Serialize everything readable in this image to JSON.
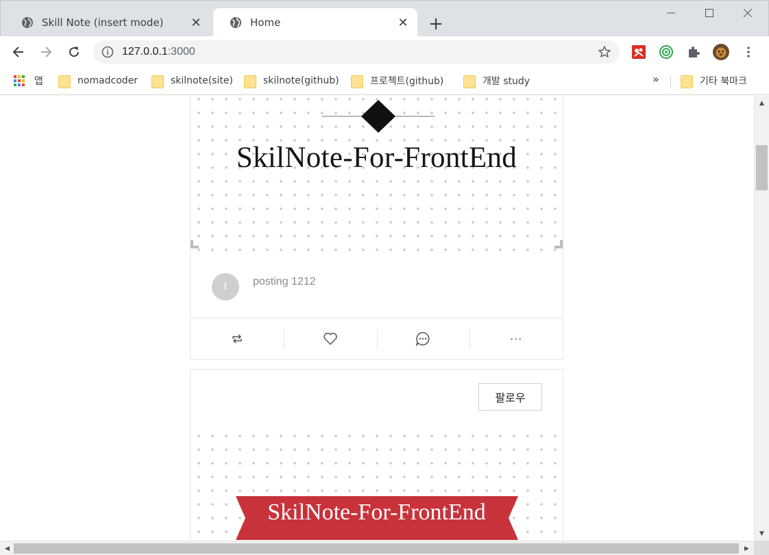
{
  "browser": {
    "tabs": [
      {
        "title": "Skill Note (insert mode)",
        "active": false
      },
      {
        "title": "Home",
        "active": true
      }
    ],
    "new_tab_label": "+",
    "close_glyph": "✕",
    "window_controls": {
      "minimize": "—",
      "maximize": "☐",
      "close": "✕"
    },
    "address": {
      "host": "127.0.0.1",
      "port": ":3000"
    },
    "bookmarks": [
      {
        "label": "앱",
        "icon": "apps-grid-icon"
      },
      {
        "label": "nomadcoder",
        "icon": "folder-icon"
      },
      {
        "label": "skilnote(site)",
        "icon": "folder-icon"
      },
      {
        "label": "skilnote(github)",
        "icon": "folder-icon"
      },
      {
        "label": "프로젝트(github)",
        "icon": "folder-icon"
      },
      {
        "label": "개발 study",
        "icon": "folder-icon"
      }
    ],
    "bookmarks_overflow": "»",
    "other_bookmarks": "기타 북마크",
    "colors": {
      "tabstrip": "#dee1e6",
      "omnibox": "#f1f3f4",
      "folder": "#fde293"
    }
  },
  "page": {
    "post1": {
      "banner_title": "SkilNote-For-FrontEnd",
      "avatar_initial": "t",
      "text": "posting 1212",
      "actions": [
        {
          "name": "repost",
          "icon": "repeat-icon"
        },
        {
          "name": "like",
          "icon": "heart-icon"
        },
        {
          "name": "comment",
          "icon": "comment-icon"
        },
        {
          "name": "more",
          "icon": "more-icon",
          "glyph": "···"
        }
      ]
    },
    "post2": {
      "follow_label": "팔로우",
      "banner_title": "SkilNote-For-FrontEnd",
      "ribbon_color": "#c8323a"
    }
  }
}
